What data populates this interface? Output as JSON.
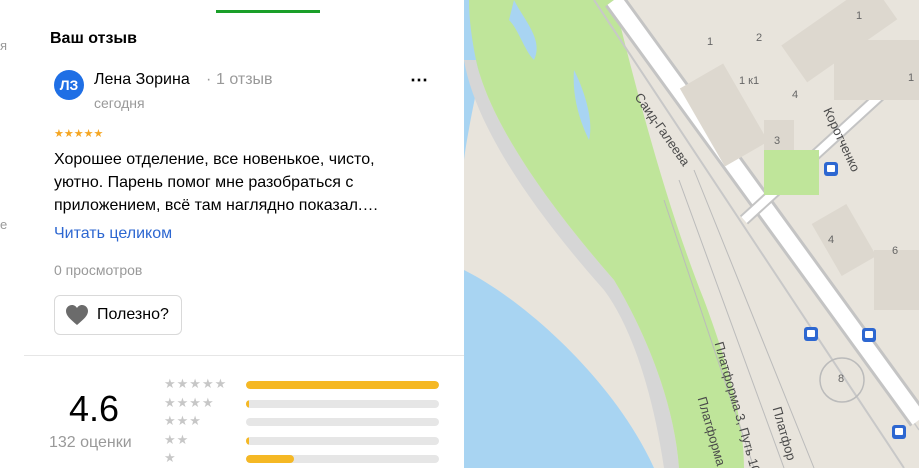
{
  "section_title": "Ваш отзыв",
  "review": {
    "avatar_initials": "ЛЗ",
    "author": "Лена Зорина",
    "separator": "·",
    "author_reviews": "1 отзыв",
    "date": "сегодня",
    "stars": "★★★★★",
    "rating": 5,
    "text": "Хорошее отделение, все новенькое, чисто, уютно. Парень помог мне разобраться с приложением, всё там наглядно показал.…",
    "read_more": "Читать целиком",
    "views": "0 просмотров",
    "useful_label": "Полезно?",
    "more_icon": "⋯"
  },
  "summary": {
    "rating_value": "4.6",
    "ratings_count": "132 оценки",
    "distribution": [
      {
        "stars": "★★★★★",
        "fraction": 1.0
      },
      {
        "stars": "★★★★",
        "fraction": 0.01
      },
      {
        "stars": "★★★",
        "fraction": 0.0
      },
      {
        "stars": "★★",
        "fraction": 0.01
      },
      {
        "stars": "★",
        "fraction": 0.25
      }
    ]
  },
  "map": {
    "street_1": "Саид-Галеева",
    "street_2": "Коротченко",
    "platform_1": "Платформа 3, Путь 10",
    "platform_2": "Платформа",
    "platform_3": "Платфор",
    "house_numbers": [
      "1",
      "1",
      "2",
      "1 к1",
      "3",
      "4",
      "4",
      "6",
      "8",
      "1"
    ],
    "colors": {
      "water": "#a8d4f2",
      "park": "#bfe59a",
      "road": "#ffffff",
      "building": "#ddd8cf"
    }
  },
  "left_strip": {
    "char_1": "я",
    "char_2": "е"
  }
}
